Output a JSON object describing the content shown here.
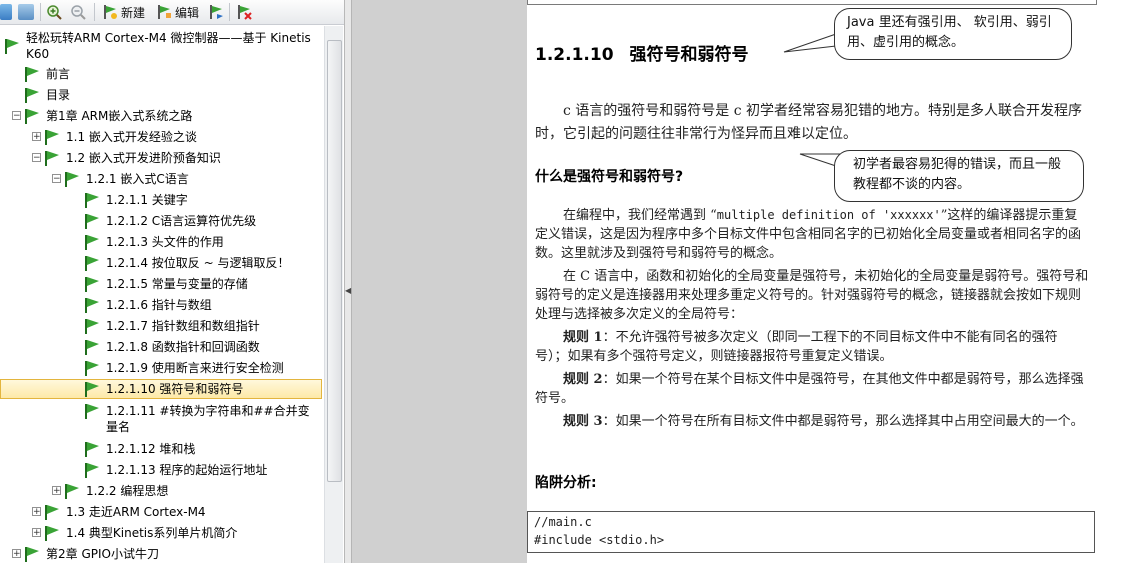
{
  "toolbar": {
    "new_label": "新建",
    "edit_label": "编辑"
  },
  "tree": {
    "book": "轻松玩转ARM Cortex-M4 微控制器——基于 Kinetis K60",
    "items": [
      {
        "label": "前言"
      },
      {
        "label": "目录"
      },
      {
        "label": "第1章  ARM嵌入式系统之路"
      },
      {
        "label": "1.1 嵌入式开发经验之谈"
      },
      {
        "label": "1.2 嵌入式开发进阶预备知识"
      },
      {
        "label": "1.2.1 嵌入式C语言"
      },
      {
        "label": "1.2.1.1 关键字"
      },
      {
        "label": "1.2.1.2 C语言运算符优先级"
      },
      {
        "label": "1.2.1.3 头文件的作用"
      },
      {
        "label": "1.2.1.4 按位取反 ~ 与逻辑取反！"
      },
      {
        "label": "1.2.1.5 常量与变量的存储"
      },
      {
        "label": "1.2.1.6 指针与数组"
      },
      {
        "label": "1.2.1.7 指针数组和数组指针"
      },
      {
        "label": "1.2.1.8 函数指针和回调函数"
      },
      {
        "label": "1.2.1.9 使用断言来进行安全检测"
      },
      {
        "label": "1.2.1.10 强符号和弱符号"
      },
      {
        "label": "1.2.1.11 #转换为字符串和##合并变量名"
      },
      {
        "label": "1.2.1.12 堆和栈"
      },
      {
        "label": "1.2.1.13 程序的起始运行地址"
      },
      {
        "label": "1.2.2 编程思想"
      },
      {
        "label": "1.3 走近ARM Cortex-M4"
      },
      {
        "label": "1.4 典型Kinetis系列单片机简介"
      },
      {
        "label": "第2章  GPIO小试牛刀"
      }
    ]
  },
  "doc": {
    "section_no": "1.2.1.10",
    "section_title": "强符号和弱符号",
    "para1": "c 语言的强符号和弱符号是 c 初学者经常容易犯错的地方。特别是多人联合开发程序时，它引起的问题往往非常行为怪异而且难以定位。",
    "q_heading": "什么是强符号和弱符号?",
    "para2a": "在编程中，我们经常遇到 “",
    "para2_code": "multiple definition of 'xxxxxx'",
    "para2b": "”这样的编译器提示重复定义错误，这是因为程序中多个目标文件中包含相同名字的已初始化全局变量或者相同名字的函数。这里就涉及到强符号和弱符号的概念。",
    "para3": "在 C 语言中，函数和初始化的全局变量是强符号，未初始化的全局变量是弱符号。强符号和弱符号的定义是连接器用来处理多重定义符号的。针对强弱符号的概念，链接器就会按如下规则处理与选择被多次定义的全局符号：",
    "rule1_title": "规则 1",
    "rule1": "：不允许强符号被多次定义（即同一工程下的不同目标文件中不能有同名的强符号）；如果有多个强符号定义，则链接器报符号重复定义错误。",
    "rule2_title": "规则 2",
    "rule2": "：如果一个符号在某个目标文件中是强符号，在其他文件中都是弱符号，那么选择强符号。",
    "rule3_title": "规则 3",
    "rule3": "：如果一个符号在所有目标文件中都是弱符号，那么选择其中占用空间最大的一个。",
    "pitfall": "陷阱分析:",
    "code1": "//main.c",
    "code2": "#include <stdio.h>",
    "callout1": "Java 里还有强引用、 软引用、弱引用、虚引用的概念。",
    "callout2": "初学者最容易犯得的错误，而且一般教程都不谈的内容。"
  },
  "colors": {
    "flag_green": "#3aa336",
    "flag_dark": "#1f6d1c",
    "selection": "#fde9a8"
  }
}
